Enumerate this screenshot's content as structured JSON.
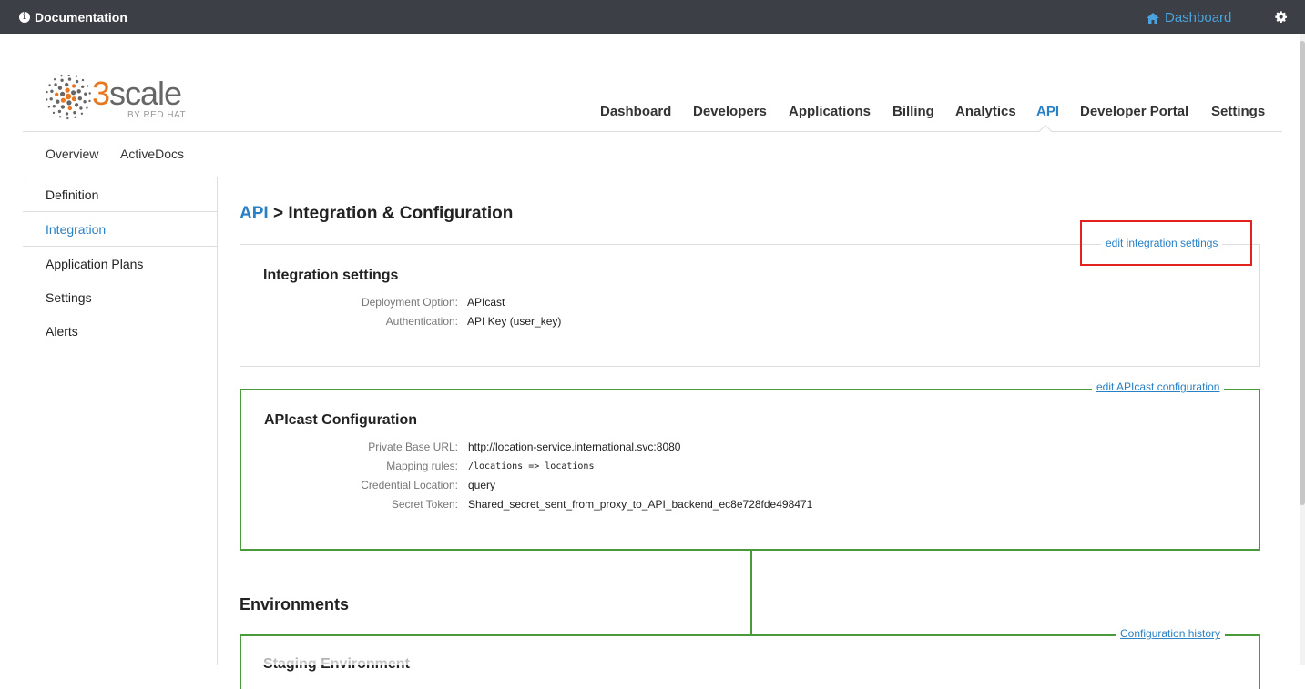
{
  "topbar": {
    "documentation_label": "Documentation",
    "dashboard_label": "Dashboard"
  },
  "logo": {
    "wordmark_prefix": "3",
    "wordmark_rest": "scale",
    "byline": "BY RED HAT"
  },
  "main_nav": {
    "items": [
      "Dashboard",
      "Developers",
      "Applications",
      "Billing",
      "Analytics",
      "API",
      "Developer Portal",
      "Settings"
    ],
    "active": "API"
  },
  "sub_nav": {
    "items": [
      "Overview",
      "ActiveDocs"
    ]
  },
  "sidebar": {
    "items": [
      "Definition",
      "Integration",
      "Application Plans",
      "Settings",
      "Alerts"
    ],
    "active": "Integration"
  },
  "breadcrumb": {
    "link": "API",
    "separator": ">",
    "current": "Integration & Configuration"
  },
  "integration_settings": {
    "title": "Integration settings",
    "edit_link": "edit integration settings",
    "fields": [
      {
        "label": "Deployment Option:",
        "value": "APIcast"
      },
      {
        "label": "Authentication:",
        "value": "API Key (user_key)"
      }
    ]
  },
  "apicast_config": {
    "title": "APIcast Configuration",
    "edit_link": "edit APIcast configuration",
    "fields": [
      {
        "label": "Private Base URL:",
        "value": "http://location-service.international.svc:8080"
      },
      {
        "label": "Mapping rules:",
        "value": "/locations => locations"
      },
      {
        "label": "Credential Location:",
        "value": "query"
      },
      {
        "label": "Secret Token:",
        "value": "Shared_secret_sent_from_proxy_to_API_backend_ec8e728fde498471"
      }
    ]
  },
  "environments": {
    "title": "Environments",
    "history_link": "Configuration history",
    "staging_title": "Staging Environment"
  },
  "colors": {
    "topbar": "#3c3f45",
    "link_blue": "#2a80c4",
    "green_border": "#4a9a3c",
    "highlight_red": "#e3221f",
    "logo_orange": "#e87722"
  }
}
